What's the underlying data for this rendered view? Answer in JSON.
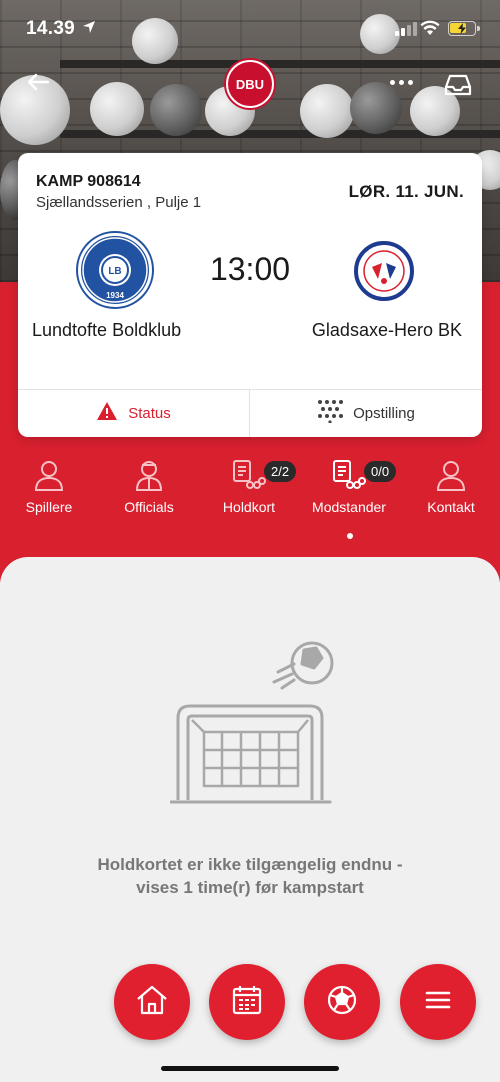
{
  "statusbar": {
    "time": "14.39"
  },
  "nav": {
    "logo_text": "DBU"
  },
  "match": {
    "kamp": "KAMP 908614",
    "league": "Sjællandsserien , Pulje 1",
    "date": "LØR. 11. JUN.",
    "kickoff": "13:00",
    "home_team": "Lundtofte Boldklub",
    "away_team": "Gladsaxe-Hero BK",
    "home_crest_text": "LB",
    "home_crest_year": "1934"
  },
  "card_buttons": {
    "status": "Status",
    "lineup": "Opstilling"
  },
  "tabs": [
    {
      "label": "Spillere",
      "icon": "person-icon"
    },
    {
      "label": "Officials",
      "icon": "referee-icon"
    },
    {
      "label": "Holdkort",
      "icon": "teamsheet-icon",
      "badge": "2/2"
    },
    {
      "label": "Modstander",
      "icon": "teamsheet-icon",
      "badge": "0/0"
    },
    {
      "label": "Kontakt",
      "icon": "contact-icon"
    }
  ],
  "content": {
    "message_line1": "Holdkortet er ikke tilgængelig endnu -",
    "message_line2": "vises 1 time(r) før kampstart"
  },
  "bottom_nav": [
    "home-icon",
    "calendar-icon",
    "football-icon",
    "menu-icon"
  ],
  "colors": {
    "accent": "#d8202f",
    "card": "#ffffff",
    "panel": "#f0f0f0"
  }
}
